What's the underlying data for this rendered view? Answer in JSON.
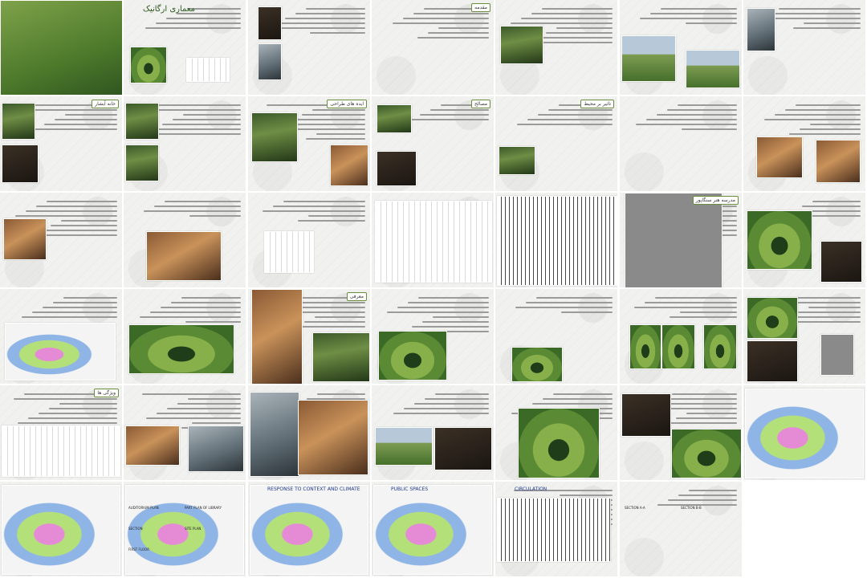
{
  "view": "slide-sorter-grid",
  "slides": [
    {
      "n": 1,
      "tag": ""
    },
    {
      "n": 2,
      "title": "معماری ارگانیک"
    },
    {
      "n": 3,
      "tag": ""
    },
    {
      "n": 4,
      "tag": "مقدمه"
    },
    {
      "n": 5,
      "tag": ""
    },
    {
      "n": 6,
      "tag": ""
    },
    {
      "n": 7,
      "tag": ""
    },
    {
      "n": 8,
      "tag": "خانه آبشار"
    },
    {
      "n": 9,
      "tag": ""
    },
    {
      "n": 10,
      "tag": "ایده های طراحی"
    },
    {
      "n": 11,
      "tag": "مصالح"
    },
    {
      "n": 12,
      "tag": "تاثیر بر محیط"
    },
    {
      "n": 13,
      "tag": ""
    },
    {
      "n": 14,
      "tag": ""
    },
    {
      "n": 15,
      "tag": ""
    },
    {
      "n": 16,
      "tag": ""
    },
    {
      "n": 17,
      "tag": ""
    },
    {
      "n": 18,
      "tag": ""
    },
    {
      "n": 19,
      "tag": ""
    },
    {
      "n": 20,
      "tag": "مدرسه هنر سنگاپور"
    },
    {
      "n": 21,
      "tag": ""
    },
    {
      "n": 22,
      "tag": ""
    },
    {
      "n": 23,
      "tag": ""
    },
    {
      "n": 24,
      "tag": "معرفی"
    },
    {
      "n": 25,
      "tag": ""
    },
    {
      "n": 26,
      "tag": ""
    },
    {
      "n": 27,
      "tag": ""
    },
    {
      "n": 28,
      "tag": ""
    },
    {
      "n": 29,
      "tag": "ویژگی ها"
    },
    {
      "n": 30,
      "tag": ""
    },
    {
      "n": 31,
      "tag": ""
    },
    {
      "n": 32,
      "tag": ""
    },
    {
      "n": 33,
      "tag": ""
    },
    {
      "n": 34,
      "tag": ""
    },
    {
      "n": 35,
      "tag": ""
    },
    {
      "n": 36,
      "tag": ""
    },
    {
      "n": 37,
      "labels": [
        "AUDITORIUM PLAN",
        "PART PLAN OF LIBRARY",
        "SECTION",
        "SITE PLAN",
        "FIRST FLOOR"
      ]
    },
    {
      "n": 38,
      "title": "RESPONSE TO CONTEXT AND CLIMATE"
    },
    {
      "n": 39,
      "title": "PUBLIC SPACES"
    },
    {
      "n": 40,
      "title": "CIRCULATION"
    },
    {
      "n": 41,
      "labels": [
        "SECTION A-A",
        "SECTION B-B"
      ]
    }
  ]
}
